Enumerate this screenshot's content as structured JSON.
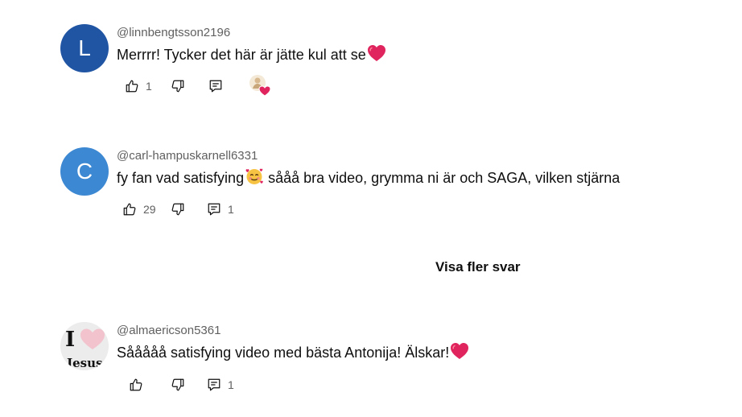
{
  "comments": [
    {
      "avatar_letter": "L",
      "avatar_color": "#2055a4",
      "username": "@linnbengtsson2196",
      "text": "Merrrr! Tycker det här är jätte kul att se",
      "text_emoji": "red-heart",
      "likes": "1",
      "replies": "",
      "creator_heart": true
    },
    {
      "avatar_letter": "C",
      "avatar_color": "#3d88d2",
      "username": "@carl-hampuskarnell6331",
      "text_before": "fy fan vad satisfying",
      "text_emoji": "smiling-face-with-hearts",
      "text_after": " sååå bra video, grymma ni är och SAGA, vilken stjärna",
      "likes": "29",
      "replies": "1",
      "creator_heart": false
    },
    {
      "avatar_letter": "I Jesus",
      "avatar_color": "#efefef",
      "username": "@almaericson5361",
      "text": "Sååååå satisfying video med bästa Antonija! Älskar!",
      "text_emoji": "red-heart",
      "likes": "",
      "replies": "1",
      "creator_heart": false
    }
  ],
  "more_replies_label": "Visa fler svar",
  "icons": {
    "like": "thumbs-up-icon",
    "dislike": "thumbs-down-icon",
    "reply": "reply-icon",
    "heart": "red-heart-icon"
  },
  "colors": {
    "text": "#0f0f0f",
    "muted": "#606060",
    "heart": "#e0245e"
  }
}
